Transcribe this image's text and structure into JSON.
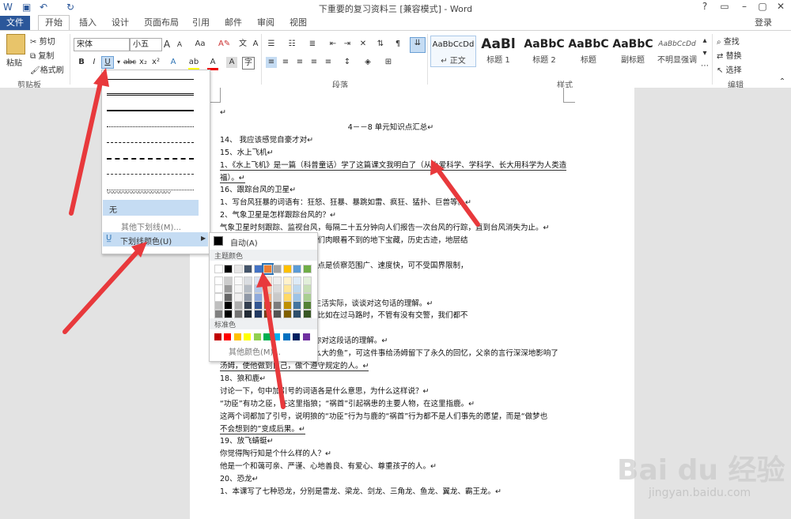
{
  "window": {
    "title": "下重要的复习资料三 [兼容模式] - Word",
    "help": "?",
    "signin": "登录"
  },
  "tabs": [
    {
      "label": "文件"
    },
    {
      "label": "开始"
    },
    {
      "label": "插入"
    },
    {
      "label": "设计"
    },
    {
      "label": "页面布局"
    },
    {
      "label": "引用"
    },
    {
      "label": "邮件"
    },
    {
      "label": "审阅"
    },
    {
      "label": "视图"
    }
  ],
  "clipboard": {
    "paste": "粘贴",
    "cut": "剪切",
    "copy": "复制",
    "painter": "格式刷",
    "group": "剪贴板"
  },
  "font": {
    "name": "宋体",
    "size": "小五",
    "bold": "B",
    "italic": "I",
    "underline": "U",
    "strike": "abc",
    "sub": "x₂",
    "sup": "x²",
    "grow": "A",
    "shrink": "A"
  },
  "paragraph": {
    "group": "段落"
  },
  "styles": {
    "group": "样式",
    "items": [
      {
        "preview": "AaBbCcDd",
        "label": "↵ 正文"
      },
      {
        "preview": "AaBl",
        "label": "标题 1"
      },
      {
        "preview": "AaBbC",
        "label": "标题 2"
      },
      {
        "preview": "AaBbC",
        "label": "标题"
      },
      {
        "preview": "AaBbC",
        "label": "副标题"
      },
      {
        "preview": "AaBbCcDd",
        "label": "不明显强调"
      }
    ]
  },
  "editing": {
    "group": "编辑",
    "find": "查找",
    "replace": "替换",
    "select": "选择"
  },
  "underline_menu": {
    "none": "无",
    "more": "其他下划线(M)...",
    "color": "下划线颜色(U)"
  },
  "color_menu": {
    "auto": "自动(A)",
    "theme_label": "主题颜色",
    "standard_label": "标准色",
    "more": "其他颜色(M)...",
    "theme_top": [
      "#ffffff",
      "#000000",
      "#e7e6e6",
      "#44546a",
      "#4472c4",
      "#ed7d31",
      "#a5a5a5",
      "#ffc000",
      "#5b9bd5",
      "#70ad47"
    ],
    "standard": [
      "#c00000",
      "#ff0000",
      "#ffc000",
      "#ffff00",
      "#92d050",
      "#00b050",
      "#00b0f0",
      "#0070c0",
      "#002060",
      "#7030a0"
    ]
  },
  "doc": {
    "lines": [
      {
        "t": "↵"
      },
      {
        "t": "4－－8 单元知识点汇总↵",
        "center": true
      },
      {
        "t": "14、 我应该感觉自豪才对↵"
      },
      {
        "t": "15、水上飞机↵"
      },
      {
        "t": "1、《水上飞机》是一篇（科普童话）学了这篇课文我明白了（从小爱科学、学科学、长大用科学为人类造",
        "u": true
      },
      {
        "t": "福）。↵",
        "u": true
      },
      {
        "t": "16、跟踪台风的卫星↵"
      },
      {
        "t": "1、写台风狂暴的词语有：狂怒、狂暴、暴跳如雷、疯狂、猛扑、巨兽等。↵"
      },
      {
        "t": "2、气象卫星是怎样跟踪台风的？↵"
      },
      {
        "t": "气象卫星时刻跟踪、监视台风，每隔二十五分钟向人们报告一次台风的行踪，直到台风消失为止。↵"
      },
      {
        "t": "卫星，它能看透地层，发现人们肉眼看不到的地下宝藏，历史古迹，地层结"
      },
      {
        "t": ""
      },
      {
        "t": "军事情报的人造地球卫星，优点是侦察范围广、速度快，可不受国界限制，"
      },
      {
        "t": ""
      },
      {
        "t": ""
      },
      {
        "t": "们都应该遵守规定”请你联系生活实际，谈谈对这句话的理解。↵"
      },
      {
        "t": "应遵守社会规定和社会公德，比如在过马路时，不管有没有交警，我们都不"
      },
      {
        "t": "灯。"
      },
      {
        "t": "一直回响在他的身边”。谈谈你对这段话的理解。↵"
      },
      {
        "t": "虽然“汤姆再也没有钓到过那么大的鱼”，可这件事给汤姆留下了永久的回忆，父亲的言行深深地影响了"
      },
      {
        "t": "汤姆，使他做到自己，做个遵守规定的人。↵",
        "u": true
      },
      {
        "t": "18、狼和鹿↵"
      },
      {
        "t": "讨论一下，句中加引号的词语各是什么意思，为什么这样说？↵"
      },
      {
        "t": "“功臣”有功之臣，在这里指狼；“祸首”引起祸患的主要人物，在这里指鹿。↵"
      },
      {
        "t": "这两个词都加了引号，说明狼的“功臣”行为与鹿的“祸首”行为都不是人们事先的愿望，而是“做梦也"
      },
      {
        "t": "不会想到的”变成后果。↵",
        "u": true
      },
      {
        "t": "19、放飞蜻蜓↵"
      },
      {
        "t": "你觉得陶行知是个什么样的人？↵"
      },
      {
        "t": "他是一个和蔼可亲、严谨、心地善良、有爱心、尊重孩子的人。↵"
      },
      {
        "t": "20、恐龙↵"
      },
      {
        "t": "1、本课写了七种恐龙，分别是雷龙、梁龙、剑龙、三角龙、鱼龙、翼龙、霸王龙。↵"
      }
    ]
  },
  "watermark": {
    "brand": "Bai du 经验",
    "url": "jingyan.baidu.com"
  }
}
